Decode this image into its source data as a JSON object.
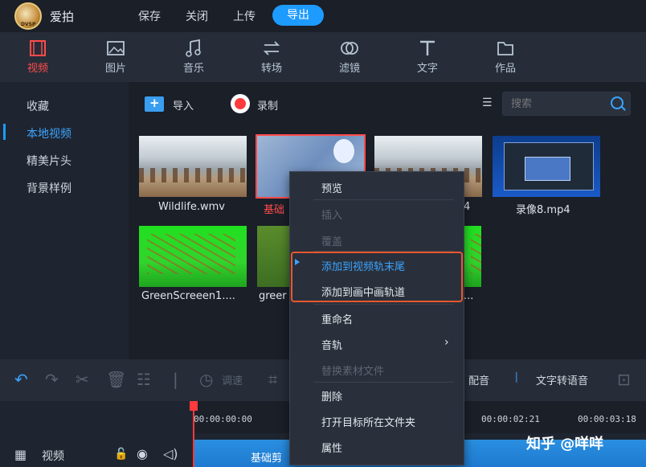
{
  "titlebar": {
    "app_name": "爱拍",
    "menu": [
      "保存",
      "关闭",
      "上传"
    ],
    "export_label": "导出"
  },
  "toolbar": {
    "tabs": [
      {
        "label": "视频",
        "icon": "film-icon",
        "active": true
      },
      {
        "label": "图片",
        "icon": "image-icon",
        "active": false
      },
      {
        "label": "音乐",
        "icon": "music-note-icon",
        "active": false
      },
      {
        "label": "转场",
        "icon": "transition-arrows-icon",
        "active": false
      },
      {
        "label": "滤镜",
        "icon": "filter-circles-icon",
        "active": false
      },
      {
        "label": "文字",
        "icon": "text-t-icon",
        "active": false
      },
      {
        "label": "作品",
        "icon": "folder-icon",
        "active": false
      }
    ]
  },
  "sidebar": {
    "items": [
      "收藏",
      "本地视频",
      "精美片头",
      "背景样例"
    ],
    "active_index": 1
  },
  "content_header": {
    "import_label": "导入",
    "record_label": "录制",
    "search_placeholder": "搜索"
  },
  "media": [
    {
      "caption": "Wildlife.wmv",
      "selected": false
    },
    {
      "caption": "基础",
      "selected": true
    },
    {
      "caption": "4",
      "selected": false
    },
    {
      "caption": "录像8.mp4",
      "selected": false
    },
    {
      "caption": "GreenScreeen1....",
      "selected": false
    },
    {
      "caption": "greer",
      "selected": false
    },
    {
      "caption": "...",
      "selected": false
    }
  ],
  "context_menu": {
    "items": [
      {
        "label": "预览",
        "enabled": true
      },
      {
        "label": "插入",
        "enabled": false
      },
      {
        "label": "覆盖",
        "enabled": false
      },
      {
        "label": "添加到视频轨末尾",
        "enabled": true
      },
      {
        "label": "添加到画中画轨道",
        "enabled": true
      },
      {
        "label": "重命名",
        "enabled": true
      },
      {
        "label": "音轨",
        "enabled": true
      },
      {
        "label": "替换素材文件",
        "enabled": false
      },
      {
        "label": "删除",
        "enabled": true
      },
      {
        "label": "打开目标所在文件夹",
        "enabled": true
      },
      {
        "label": "属性",
        "enabled": true
      }
    ]
  },
  "edit_bar": {
    "speed_label": "调速",
    "dub_label": "配音",
    "tts_label": "文字转语音"
  },
  "timeline": {
    "timecodes": [
      "00:00:00:00",
      "00:00:02:21",
      "00:00:03:18"
    ],
    "track_label": "视频",
    "clip_name": "基础剪"
  },
  "watermark": "知乎 @咩咩",
  "colors": {
    "accent": "#1e9bff",
    "active_tab": "#ff4b4b",
    "highlight_box": "#e8572e"
  }
}
